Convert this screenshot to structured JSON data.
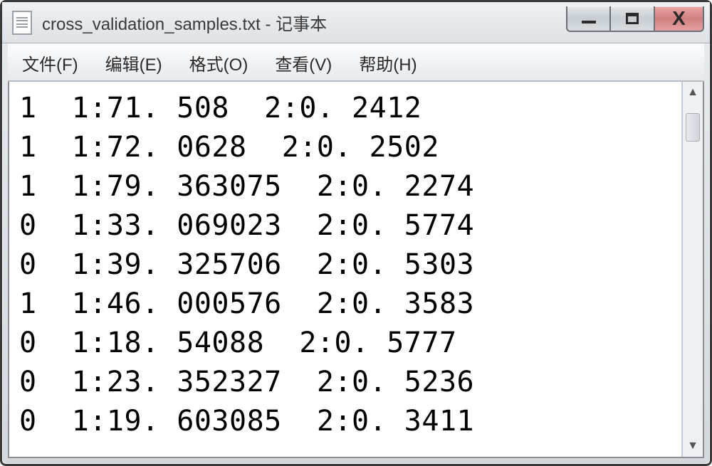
{
  "window": {
    "title": "cross_validation_samples.txt - 记事本"
  },
  "menu": {
    "file": "文件(F)",
    "edit": "编辑(E)",
    "format": "格式(O)",
    "view": "查看(V)",
    "help": "帮助(H)"
  },
  "content": {
    "lines": [
      "1  1:71. 508  2:0. 2412",
      "1  1:72. 0628  2:0. 2502",
      "1  1:79. 363075  2:0. 2274",
      "0  1:33. 069023  2:0. 5774",
      "0  1:39. 325706  2:0. 5303",
      "1  1:46. 000576  2:0. 3583",
      "0  1:18. 54088  2:0. 5777",
      "0  1:23. 352327  2:0. 5236",
      "0  1:19. 603085  2:0. 3411"
    ]
  }
}
